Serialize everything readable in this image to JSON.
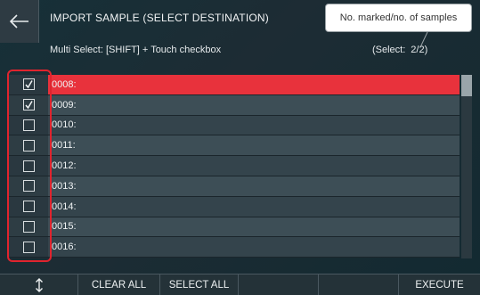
{
  "header": {
    "title": "IMPORT SAMPLE (SELECT DESTINATION)",
    "subtitle": "Multi Select: [SHIFT] + Touch checkbox",
    "select_label": "(Select:",
    "select_value": "2/2)"
  },
  "callout": {
    "text": "No. marked/no. of samples"
  },
  "list": {
    "items": [
      {
        "label": "0008:",
        "checked": true,
        "selected": true
      },
      {
        "label": "0009:",
        "checked": true,
        "selected": false
      },
      {
        "label": "0010:",
        "checked": false,
        "selected": false
      },
      {
        "label": "0011:",
        "checked": false,
        "selected": false
      },
      {
        "label": "0012:",
        "checked": false,
        "selected": false
      },
      {
        "label": "0013:",
        "checked": false,
        "selected": false
      },
      {
        "label": "0014:",
        "checked": false,
        "selected": false
      },
      {
        "label": "0015:",
        "checked": false,
        "selected": false
      },
      {
        "label": "0016:",
        "checked": false,
        "selected": false
      }
    ]
  },
  "footer": {
    "updown_icon": "up-down-arrow-icon",
    "clear_all": "CLEAR ALL",
    "select_all": "SELECT ALL",
    "execute": "EXECUTE"
  },
  "colors": {
    "selected_row": "#e8323c",
    "highlight_box": "#e0242e"
  }
}
